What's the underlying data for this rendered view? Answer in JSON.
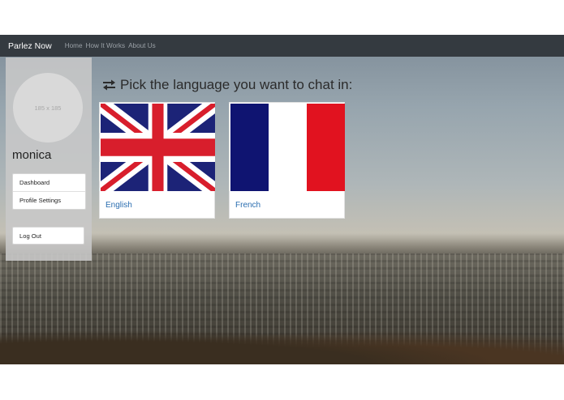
{
  "navbar": {
    "brand": "Parlez Now",
    "links": [
      "Home",
      "How It Works",
      "About Us"
    ]
  },
  "sidebar": {
    "avatar_placeholder": "185 x 185",
    "username": "monica",
    "menu": [
      "Dashboard",
      "Profile Settings"
    ],
    "logout_label": "Log Out"
  },
  "main": {
    "heading": "Pick the language you want to chat in:",
    "heading_icon": "exchange-arrows-icon",
    "languages": [
      {
        "label": "English",
        "flag": "uk-flag"
      },
      {
        "label": "French",
        "flag": "france-flag"
      }
    ]
  },
  "colors": {
    "navbar_bg": "#343a40",
    "link_blue": "#2a6db0",
    "france_blue": "#0f1471",
    "france_red": "#e1121f",
    "uk_blue": "#1c2377",
    "uk_red": "#d81e2c"
  }
}
